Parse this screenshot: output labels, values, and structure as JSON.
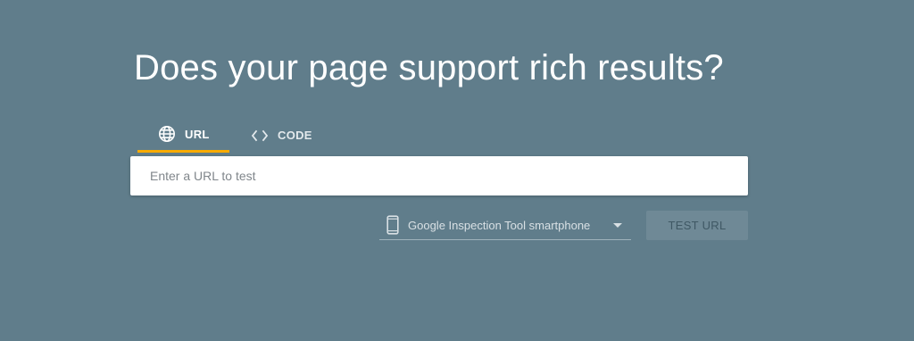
{
  "page": {
    "title": "Does your page support rich results?",
    "background_color": "#607d8b"
  },
  "tabs": [
    {
      "label": "URL",
      "icon": "globe-icon",
      "active": true
    },
    {
      "label": "CODE",
      "icon": "code-brackets-icon",
      "active": false
    }
  ],
  "accent_color": "#f9ab00",
  "url_input": {
    "placeholder": "Enter a URL to test",
    "value": ""
  },
  "device_select": {
    "icon": "smartphone-icon",
    "selected": "Google Inspection Tool smartphone"
  },
  "test_button": {
    "label": "TEST URL",
    "enabled": false
  }
}
